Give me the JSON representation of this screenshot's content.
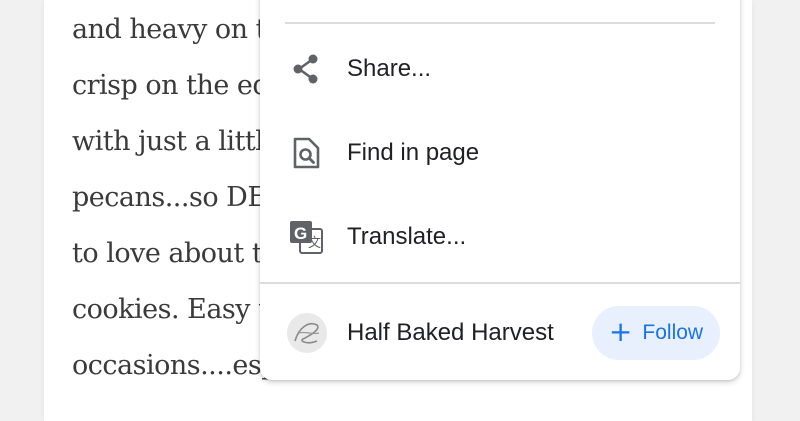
{
  "article": {
    "lines": [
      "and heavy on th",
      "crisp on the ed",
      "with just a littl",
      "pecans...so DE",
      "to love about th",
      "cookies. Easy t",
      "occasions....esp"
    ]
  },
  "menu": {
    "items": [
      {
        "label": "Share...",
        "icon": "share-icon"
      },
      {
        "label": "Find in page",
        "icon": "find-in-page-icon"
      },
      {
        "label": "Translate...",
        "icon": "translate-icon"
      }
    ],
    "follow": {
      "site_name": "Half Baked Harvest",
      "button_label": "Follow",
      "button_icon": "plus-icon",
      "avatar": "site-logo-avatar"
    }
  },
  "colors": {
    "accent": "#1a73e8",
    "follow_bg": "#e8f0fe",
    "icon_gray": "#5f6368",
    "text": "#202124"
  }
}
